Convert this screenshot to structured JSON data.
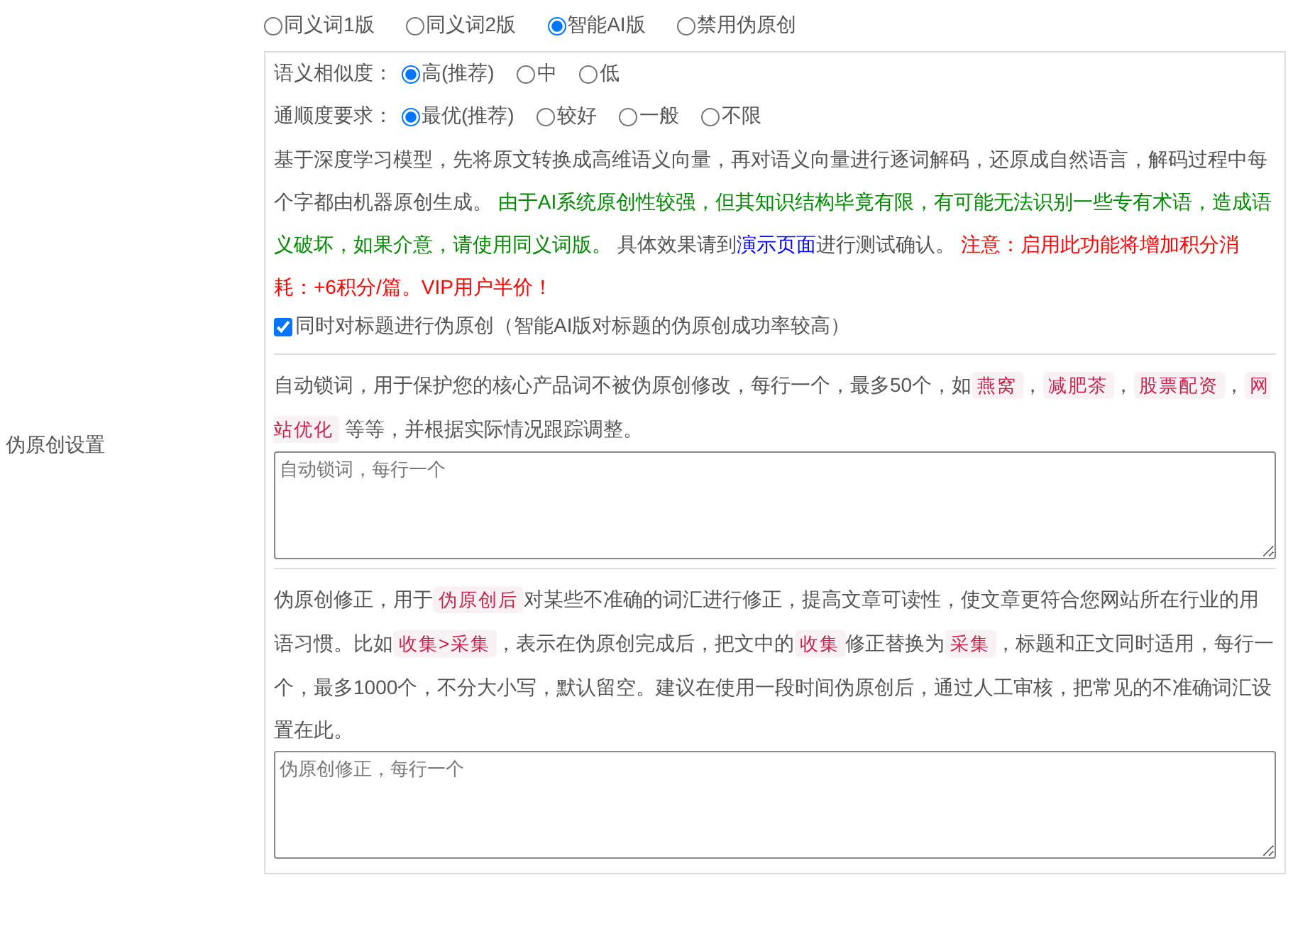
{
  "section_label": "伪原创设置",
  "mode_options": [
    {
      "label": "同义词1版",
      "selected": false
    },
    {
      "label": "同义词2版",
      "selected": false
    },
    {
      "label": "智能AI版",
      "selected": true
    },
    {
      "label": "禁用伪原创",
      "selected": false
    }
  ],
  "settings": [
    {
      "label": "语义相似度：",
      "options": [
        {
          "label": "高(推荐)",
          "selected": true
        },
        {
          "label": "中",
          "selected": false
        },
        {
          "label": "低",
          "selected": false
        }
      ]
    },
    {
      "label": "通顺度要求：",
      "options": [
        {
          "label": "最优(推荐)",
          "selected": true
        },
        {
          "label": "较好",
          "selected": false
        },
        {
          "label": "一般",
          "selected": false
        },
        {
          "label": "不限",
          "selected": false
        }
      ]
    }
  ],
  "description": [
    {
      "kind": "plain",
      "text": "基于深度学习模型，先将原文转换成高维语义向量，再对语义向量进行逐词解码，还原成自然语言，解码过程中每个字都由机器原创生成。 "
    },
    {
      "kind": "green",
      "text": "由于AI系统原创性较强，但其知识结构毕竟有限，有可能无法识别一些专有术语，造成语义破坏，如果介意，请使用同义词版。"
    },
    {
      "kind": "plain",
      "text": " 具体效果请到"
    },
    {
      "kind": "link",
      "text": "演示页面"
    },
    {
      "kind": "plain",
      "text": "进行测试确认。 "
    },
    {
      "kind": "red",
      "text": "注意：启用此功能将增加积分消耗：+6积分/篇。VIP用户半价！"
    }
  ],
  "title_option": {
    "label": "同时对标题进行伪原创（智能AI版对标题的伪原创成功率较高）",
    "checked": true
  },
  "lock_words": {
    "help": [
      {
        "kind": "plain",
        "text": "自动锁词，用于保护您的核心产品词不被伪原创修改，每行一个，最多50个，如"
      },
      {
        "kind": "code",
        "text": "燕窝"
      },
      {
        "kind": "plain",
        "text": "，"
      },
      {
        "kind": "code",
        "text": "减肥茶"
      },
      {
        "kind": "plain",
        "text": "，"
      },
      {
        "kind": "code",
        "text": "股票配资"
      },
      {
        "kind": "plain",
        "text": "，"
      },
      {
        "kind": "code",
        "text": "网站优化"
      },
      {
        "kind": "plain",
        "text": " 等等，并根据实际情况跟踪调整。"
      }
    ],
    "placeholder": "自动锁词，每行一个"
  },
  "corrections": {
    "help": [
      {
        "kind": "plain",
        "text": "伪原创修正，用于"
      },
      {
        "kind": "code",
        "text": "伪原创后"
      },
      {
        "kind": "plain",
        "text": "对某些不准确的词汇进行修正，提高文章可读性，使文章更符合您网站所在行业的用语习惯。比如"
      },
      {
        "kind": "code",
        "text": "收集>采集"
      },
      {
        "kind": "plain",
        "text": "，表示在伪原创完成后，把文中的"
      },
      {
        "kind": "code",
        "text": "收集"
      },
      {
        "kind": "plain",
        "text": "修正替换为"
      },
      {
        "kind": "code",
        "text": "采集"
      },
      {
        "kind": "plain",
        "text": "，标题和正文同时适用，每行一个，最多1000个，不分大小写，默认留空。建议在使用一段时间伪原创后，通过人工审核，把常见的不准确词汇设置在此。"
      }
    ],
    "placeholder": "伪原创修正，每行一个"
  }
}
